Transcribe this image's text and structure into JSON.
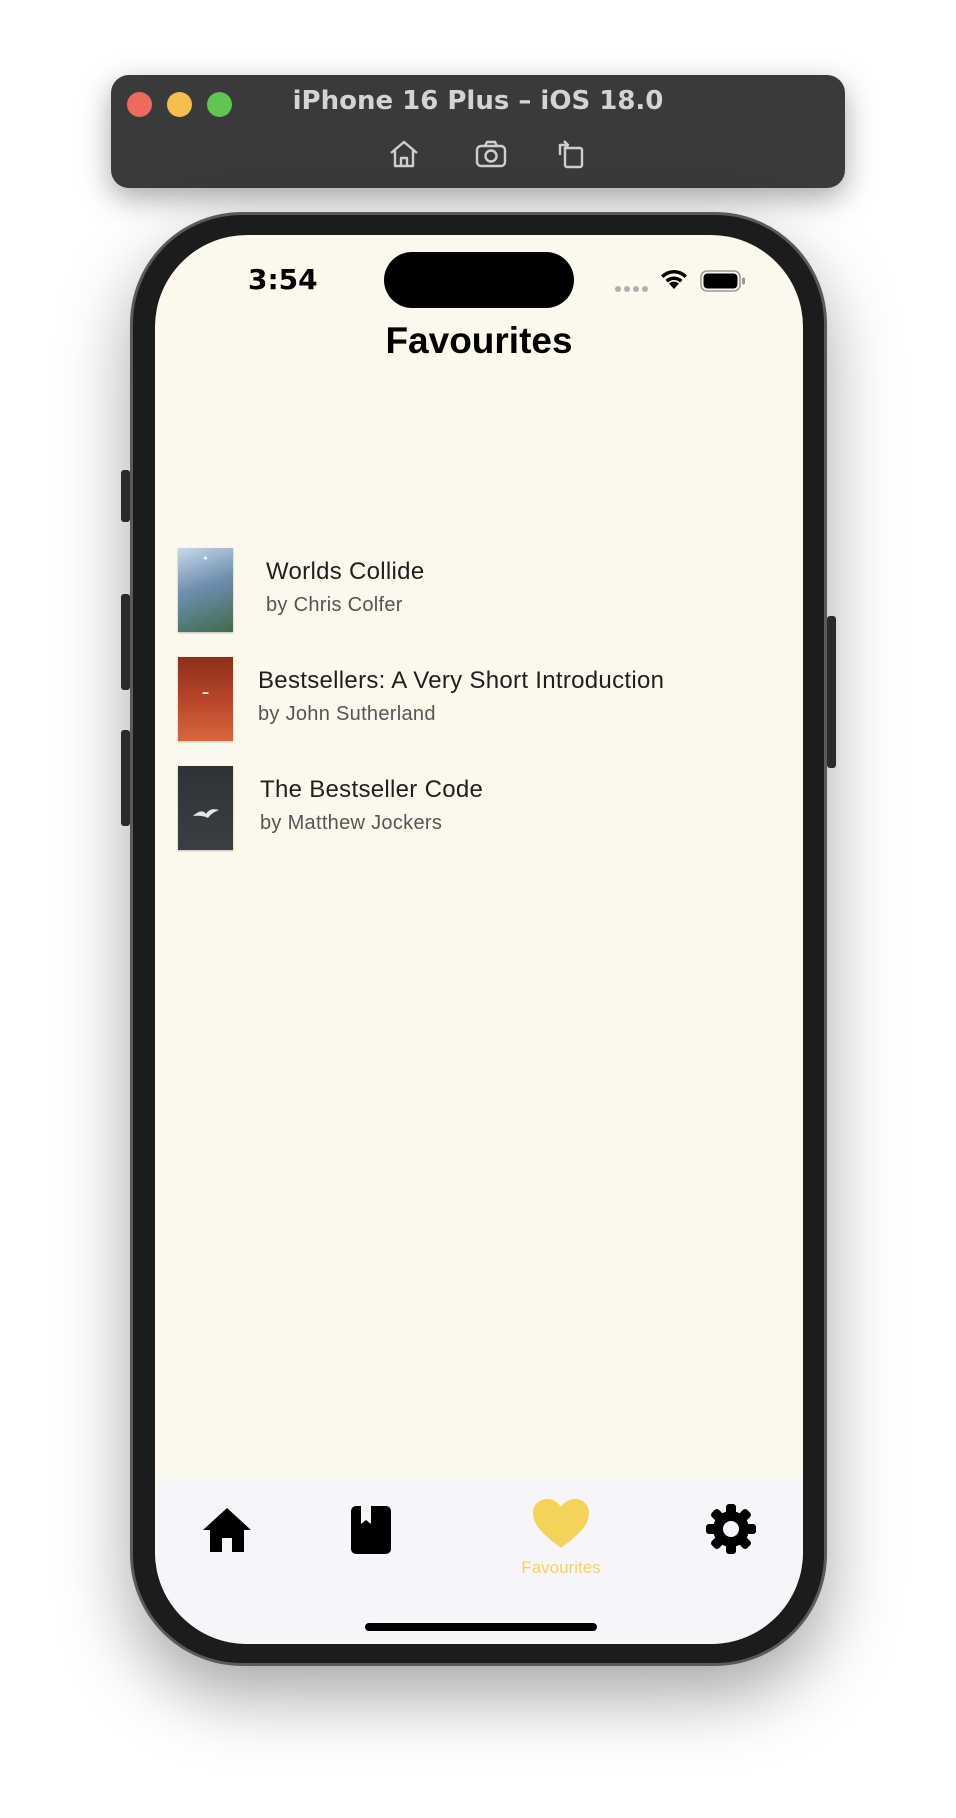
{
  "simulator": {
    "title": "iPhone 16 Plus – iOS 18.0",
    "tools": [
      "home-icon",
      "screenshot-icon",
      "rotate-icon"
    ]
  },
  "status_bar": {
    "time": "3:54"
  },
  "page": {
    "title": "Favourites"
  },
  "favourites": [
    {
      "title": "Worlds Collide",
      "author": "by Chris Colfer",
      "cover_color": "#6f8fb0"
    },
    {
      "title": "Bestsellers: A Very Short Introduction",
      "author": "by John Sutherland",
      "cover_color": "#b8442a"
    },
    {
      "title": "The Bestseller Code",
      "author": "by Matthew Jockers",
      "cover_color": "#3b3f44"
    }
  ],
  "tab_bar": {
    "items": [
      {
        "icon": "home-icon",
        "label": ""
      },
      {
        "icon": "book-icon",
        "label": ""
      },
      {
        "icon": "heart-icon",
        "label": "Favourites",
        "active": true
      },
      {
        "icon": "gear-icon",
        "label": ""
      }
    ],
    "active_color": "#f4d35b"
  },
  "colors": {
    "background": "#fcf9ec",
    "tab_background": "#f8f5fa"
  }
}
